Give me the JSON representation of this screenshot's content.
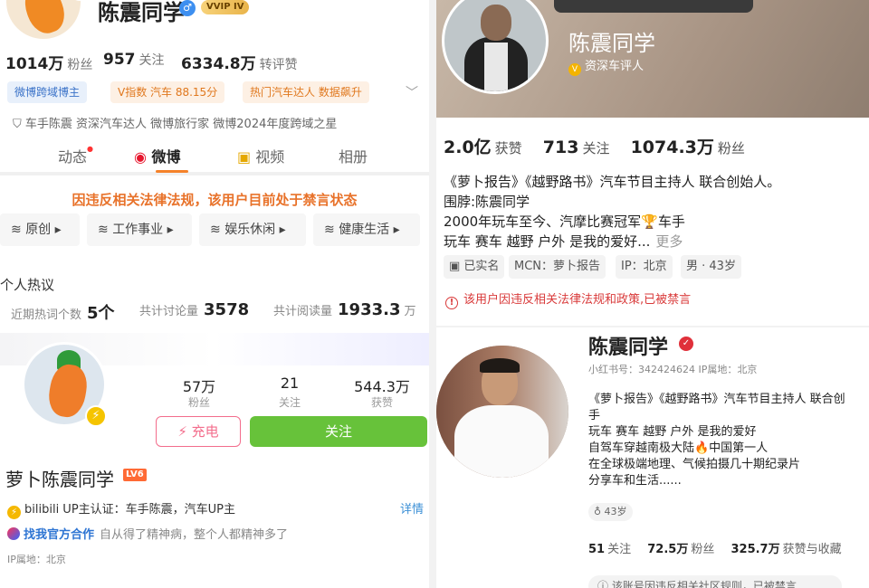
{
  "weibo": {
    "name": "陈震同学",
    "vvip": "VVIP IV",
    "v_badge": "V",
    "followers_num": "1014万",
    "followers_lbl": "粉丝",
    "following_num": "957",
    "following_lbl": "关注",
    "reposts_num": "6334.8万",
    "reposts_lbl": "转评赞",
    "tags": [
      "微博跨域博主",
      "V指数 汽车 88.15分",
      "热门汽车达人 数据飙升"
    ],
    "verify": "车手陈震 资深汽车达人  微博旅行家 微博2024年度跨域之星",
    "tabs": [
      "动态",
      "微博",
      "视频",
      "相册"
    ],
    "ban_notice": "因违反相关法律法规，该用户目前处于禁言状态",
    "chips": [
      "原创",
      "工作事业",
      "娱乐休闲",
      "健康生活"
    ],
    "hot_title": "个人热议",
    "hot_recent_lbl": "近期热词个数",
    "hot_recent_num": "5个",
    "hot_discuss_lbl": "共计讨论量",
    "hot_discuss_num": "3578",
    "hot_read_lbl": "共计阅读量",
    "hot_read_num": "1933.3",
    "hot_read_unit": "万"
  },
  "bilibili": {
    "fans_num": "57万",
    "fans_lbl": "粉丝",
    "following_num": "21",
    "following_lbl": "关注",
    "likes_num": "544.3万",
    "likes_lbl": "获赞",
    "charge": "充电",
    "follow": "关注",
    "name": "萝卜陈震同学",
    "level": "LV6",
    "up_cert": "bilibili UP主认证：车手陈震，汽车UP主",
    "detail": "详情",
    "coop": "找我官方合作",
    "bio": "自从得了精神病，整个人都精神多了",
    "ip": "IP属地：北京"
  },
  "douyin": {
    "name": "陈震同学",
    "sub": "资深车评人",
    "likes_num": "2.0亿",
    "likes_lbl": "获赞",
    "following_num": "713",
    "following_lbl": "关注",
    "fans_num": "1074.3万",
    "fans_lbl": "粉丝",
    "bio": [
      "《萝卜报告》《越野路书》汽车节目主持人 联合创始人。",
      "围脖:陈震同学",
      "2000年玩车至今、汽摩比赛冠军🏆车手",
      "玩车 赛车 越野 户外 是我的爱好..."
    ],
    "more": "更多",
    "chips": [
      "已实名",
      "MCN：萝卜报告",
      "IP：北京",
      "男 · 43岁"
    ],
    "ban": "该用户因违反相关法律法规和政策,已被禁言"
  },
  "xiaohongshu": {
    "name": "陈震同学",
    "id_line": "小红书号：342424624   IP属地：北京",
    "bio": [
      "《萝卜报告》《越野路书》汽车节目主持人 联合创",
      "手",
      "玩车 赛车 越野 户外 是我的爱好",
      "自驾车穿越南极大陆🔥中国第一人",
      "在全球极端地理、气候拍摄几十期纪录片",
      "分享车和生活......"
    ],
    "age": "♁ 43岁",
    "following_num": "51",
    "following_lbl": "关注",
    "fans_num": "72.5万",
    "fans_lbl": "粉丝",
    "likes_num": "325.7万",
    "likes_lbl": "获赞与收藏",
    "ban": "ⓘ  该账号因违反相关社区规则，已被禁言"
  }
}
